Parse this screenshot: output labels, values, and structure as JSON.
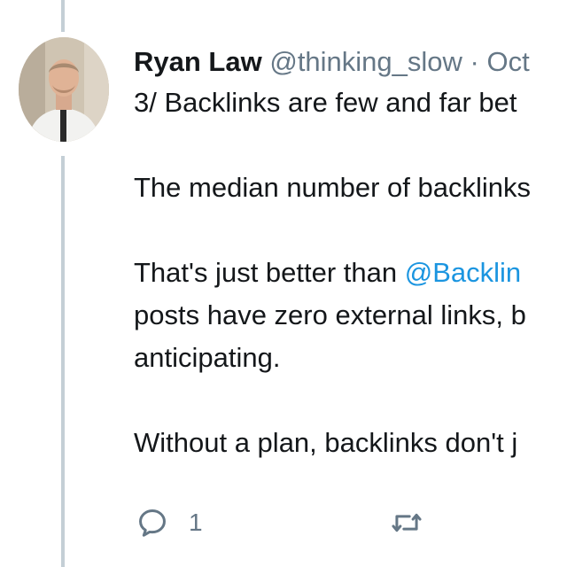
{
  "colors": {
    "text": "#14171a",
    "secondary": "#657786",
    "link": "#1b95e0",
    "thread_line": "#c4cfd6"
  },
  "tweet": {
    "author": {
      "display_name": "Ryan Law",
      "handle": "@thinking_slow",
      "separator": "·",
      "date": "Oct"
    },
    "lines": {
      "line1": "3/ Backlinks are few and far bet",
      "line2": "The median number of backlinks",
      "line3_prefix": "That's just better than ",
      "line3_mention": "@Backlin",
      "line4": "posts have zero external links, b",
      "line5": "anticipating.",
      "line6": "Without a plan, backlinks don't j"
    },
    "actions": {
      "reply_icon": "reply-icon",
      "reply_count": "1",
      "retweet_icon": "retweet-icon"
    }
  }
}
